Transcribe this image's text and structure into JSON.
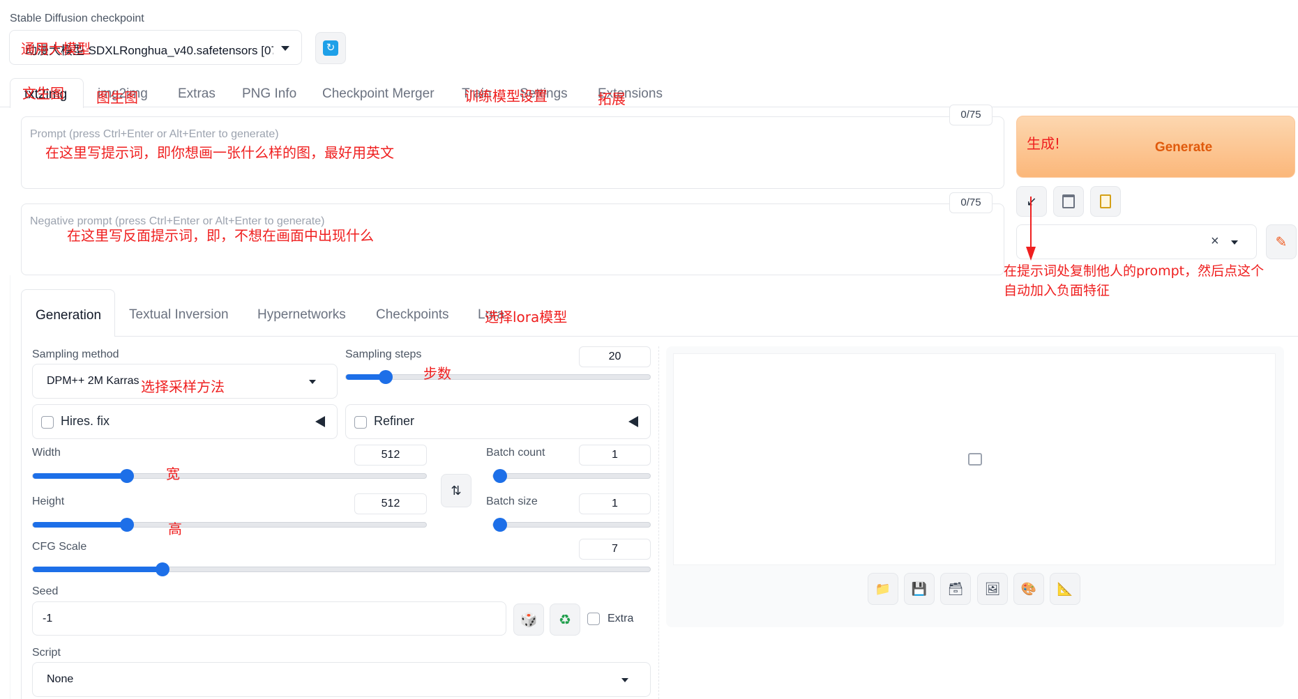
{
  "checkpoint": {
    "label": "Stable Diffusion checkpoint",
    "value": "动漫大模型-SDXLRonghua_v40.safetensors [07:",
    "annotation": "通用大模型"
  },
  "tabs": [
    {
      "label": "txt2img",
      "annotation": "文生图"
    },
    {
      "label": "img2img",
      "annotation": "图生图"
    },
    {
      "label": "Extras",
      "annotation": ""
    },
    {
      "label": "PNG Info",
      "annotation": ""
    },
    {
      "label": "Checkpoint Merger",
      "annotation": ""
    },
    {
      "label": "Train",
      "annotation": "训练模型"
    },
    {
      "label": "Settings",
      "annotation": "设置"
    },
    {
      "label": "Extensions",
      "annotation": "拓展"
    }
  ],
  "prompt": {
    "placeholder": "Prompt (press Ctrl+Enter or Alt+Enter to generate)",
    "counter": "0/75",
    "annotation": "在这里写提示词，即你想画一张什么样的图，最好用英文"
  },
  "negative_prompt": {
    "placeholder": "Negative prompt (press Ctrl+Enter or Alt+Enter to generate)",
    "counter": "0/75",
    "annotation": "在这里写反面提示词，即，不想在画面中出现什么"
  },
  "generate": {
    "label": "Generate",
    "annotation": "生成!"
  },
  "tool_annotation_line1": "在提示词处复制他人的prompt，然后点这个",
  "tool_annotation_line2": "自动加入负面特征",
  "style_clear": "×",
  "subtabs": [
    {
      "label": "Generation"
    },
    {
      "label": "Textual Inversion"
    },
    {
      "label": "Hypernetworks"
    },
    {
      "label": "Checkpoints"
    },
    {
      "label": "Lora",
      "annotation": "选择lora模型"
    }
  ],
  "sampling_method": {
    "label": "Sampling method",
    "value": "DPM++ 2M Karras",
    "annotation": "选择采样方法"
  },
  "sampling_steps": {
    "label": "Sampling steps",
    "value": "20",
    "fraction": 0.13,
    "annotation": "步数"
  },
  "hires_fix": {
    "label": "Hires. fix"
  },
  "refiner": {
    "label": "Refiner"
  },
  "width": {
    "label": "Width",
    "value": "512",
    "fraction": 0.24,
    "annotation": "宽"
  },
  "height": {
    "label": "Height",
    "value": "512",
    "fraction": 0.24,
    "annotation": "高"
  },
  "batch_count": {
    "label": "Batch count",
    "value": "1",
    "fraction": 0.0
  },
  "batch_size": {
    "label": "Batch size",
    "value": "1",
    "fraction": 0.0
  },
  "cfg_scale": {
    "label": "CFG Scale",
    "value": "7",
    "fraction": 0.21
  },
  "seed": {
    "label": "Seed",
    "value": "-1",
    "extra_label": "Extra"
  },
  "script": {
    "label": "Script",
    "value": "None"
  },
  "colors": {
    "accent": "#1d6fe8",
    "generate_text": "#e05a0c",
    "annotation": "#ef1f1f"
  }
}
